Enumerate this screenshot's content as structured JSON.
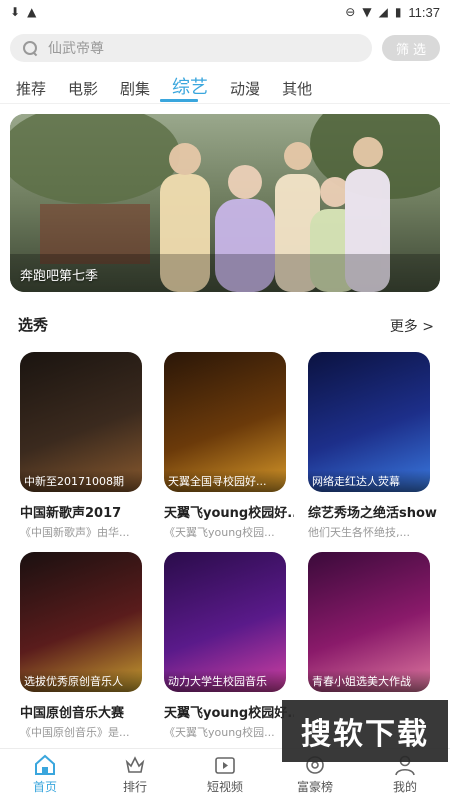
{
  "status_bar": {
    "time": "11:37",
    "icons": [
      "download-icon",
      "notification-icon",
      "dnd-icon",
      "wifi-icon",
      "signal-icon",
      "battery-icon"
    ]
  },
  "search": {
    "placeholder": "仙武帝尊",
    "filter_label": "筛选"
  },
  "tabs": [
    {
      "label": "推荐",
      "active": false
    },
    {
      "label": "电影",
      "active": false
    },
    {
      "label": "剧集",
      "active": false
    },
    {
      "label": "综艺",
      "active": true
    },
    {
      "label": "动漫",
      "active": false
    },
    {
      "label": "其他",
      "active": false
    }
  ],
  "banner": {
    "caption": "奔跑吧第七季"
  },
  "section": {
    "title": "选秀",
    "more_label": "更多 >"
  },
  "cards": [
    {
      "overlay": "中新至20171008期",
      "title": "中国新歌声2017",
      "subtitle": "《中国新歌声》由华...",
      "colors": [
        "#1a1410",
        "#3b2a1e",
        "#8a5a2e"
      ]
    },
    {
      "overlay": "天翼全国寻校园好...",
      "title": "天翼飞young校园好...",
      "subtitle": "《天翼飞young校园...",
      "colors": [
        "#2a1608",
        "#6b3a0a",
        "#d89a2a"
      ]
    },
    {
      "overlay": "网络走红达人荧幕",
      "title": "综艺秀场之绝活show",
      "subtitle": "他们天生各怀绝技,...",
      "colors": [
        "#0b1240",
        "#1d2f8a",
        "#3a7ae0"
      ]
    },
    {
      "overlay": "选拔优秀原创音乐人",
      "title": "中国原创音乐大赛",
      "subtitle": "《中国原创音乐》是...",
      "colors": [
        "#1a1010",
        "#5a1c1c",
        "#c8a030"
      ]
    },
    {
      "overlay": "动力大学生校园音乐",
      "title": "天翼飞young校园好...",
      "subtitle": "《天翼飞young校园...",
      "colors": [
        "#2a0c4a",
        "#5a1a8a",
        "#d040a0"
      ]
    },
    {
      "overlay": "青春小姐选美大作战",
      "title": "",
      "subtitle": "",
      "colors": [
        "#3a0a3a",
        "#8a1a6a",
        "#e07aa0"
      ]
    }
  ],
  "bottom_nav": [
    {
      "label": "首页",
      "icon": "home-icon",
      "active": true
    },
    {
      "label": "排行",
      "icon": "ranking-icon",
      "active": false
    },
    {
      "label": "短视频",
      "icon": "short-video-icon",
      "active": false
    },
    {
      "label": "富豪榜",
      "icon": "rich-list-icon",
      "active": false
    },
    {
      "label": "我的",
      "icon": "profile-icon",
      "active": false
    }
  ],
  "watermark": "搜软下载",
  "colors": {
    "accent": "#3aa6dd",
    "search_bg": "#eeeeee",
    "filter_bg": "#d9d9d9"
  }
}
